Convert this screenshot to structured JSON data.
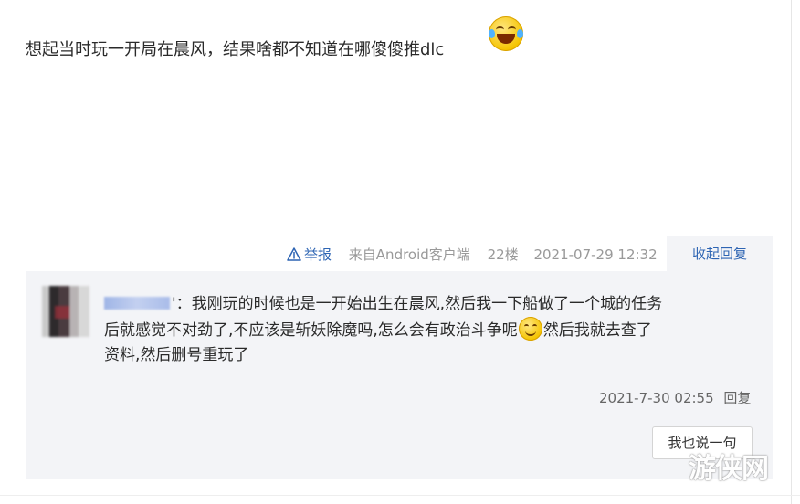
{
  "post": {
    "text": "想起当时玩一开局在晨风，结果啥都不知道在哪傻傻推dlc",
    "emoji": "laughing-tears-emoji"
  },
  "meta": {
    "report_label": "举报",
    "from": "来自Android客户端",
    "floor": "22楼",
    "datetime": "2021-07-29 12:32",
    "collapse_reply": "收起回复"
  },
  "reply": {
    "username_suffix": "'：",
    "line1": "我刚玩的时候也是一开始出生在晨风,然后我一下船做了一个城的任务",
    "line2a": "后就感觉不对劲了,不应该是斩妖除魔吗,怎么会有政治斗争呢",
    "line2b": "然后我就去查了",
    "line3": "资料,然后删号重玩了",
    "datetime": "2021-7-30 02:55",
    "reply_link": "回复",
    "say_button": "我也说一句"
  },
  "watermark": "游侠网",
  "colors": {
    "link": "#2d64b3",
    "reply_bg": "#f3f4f7"
  }
}
